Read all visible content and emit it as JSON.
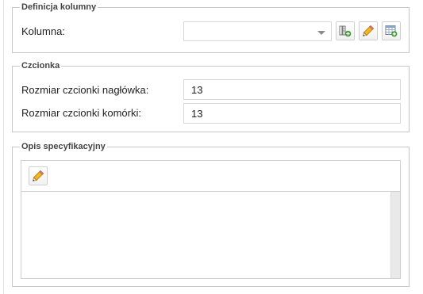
{
  "column_definition": {
    "legend": "Definicja kolumny",
    "column_label": "Kolumna:",
    "column_value": "",
    "buttons": [
      {
        "name": "add-column-button",
        "icon": "column-add-icon"
      },
      {
        "name": "edit-column-button",
        "icon": "pencil-icon"
      },
      {
        "name": "table-add-button",
        "icon": "table-add-icon"
      }
    ]
  },
  "font": {
    "legend": "Czcionka",
    "header_size_label": "Rozmiar czcionki nagłówka:",
    "header_size_value": "13",
    "cell_size_label": "Rozmiar czcionki komórki:",
    "cell_size_value": "13"
  },
  "specification": {
    "legend": "Opis specyfikacyjny",
    "edit_icon": "pencil-icon",
    "text": ""
  },
  "colors": {
    "border": "#c8c8c8",
    "icon_green": "#3a9a2a",
    "pencil_yellow": "#f2b61c"
  }
}
